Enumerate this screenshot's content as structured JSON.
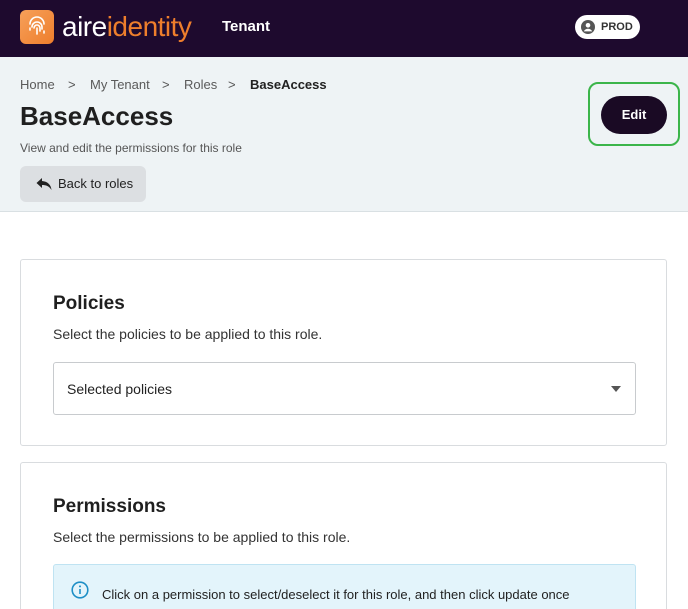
{
  "topbar": {
    "brand_part1": "aire",
    "brand_part2": "identity",
    "section": "Tenant",
    "environment": "PROD",
    "colors": {
      "background": "#1e0a2e",
      "accent": "#ee7e2c"
    }
  },
  "breadcrumb": {
    "items": [
      "Home",
      "My Tenant",
      "Roles",
      "BaseAccess"
    ],
    "separator": ">"
  },
  "page": {
    "title": "BaseAccess",
    "subtitle": "View and edit the permissions for this role",
    "back_label": "Back to roles",
    "edit_label": "Edit"
  },
  "policies": {
    "title": "Policies",
    "description": "Select the policies to be applied to this role.",
    "select_value": "Selected policies"
  },
  "permissions": {
    "title": "Permissions",
    "description": "Select the permissions to be applied to this role.",
    "info_text": "Click on a permission to select/deselect it for this role, and then click update once finished."
  },
  "icons": {
    "logo": "fingerprint-icon",
    "user": "user-circle-icon",
    "back": "back-arrow-icon",
    "info": "info-icon",
    "dropdown": "chevron-down-icon"
  }
}
